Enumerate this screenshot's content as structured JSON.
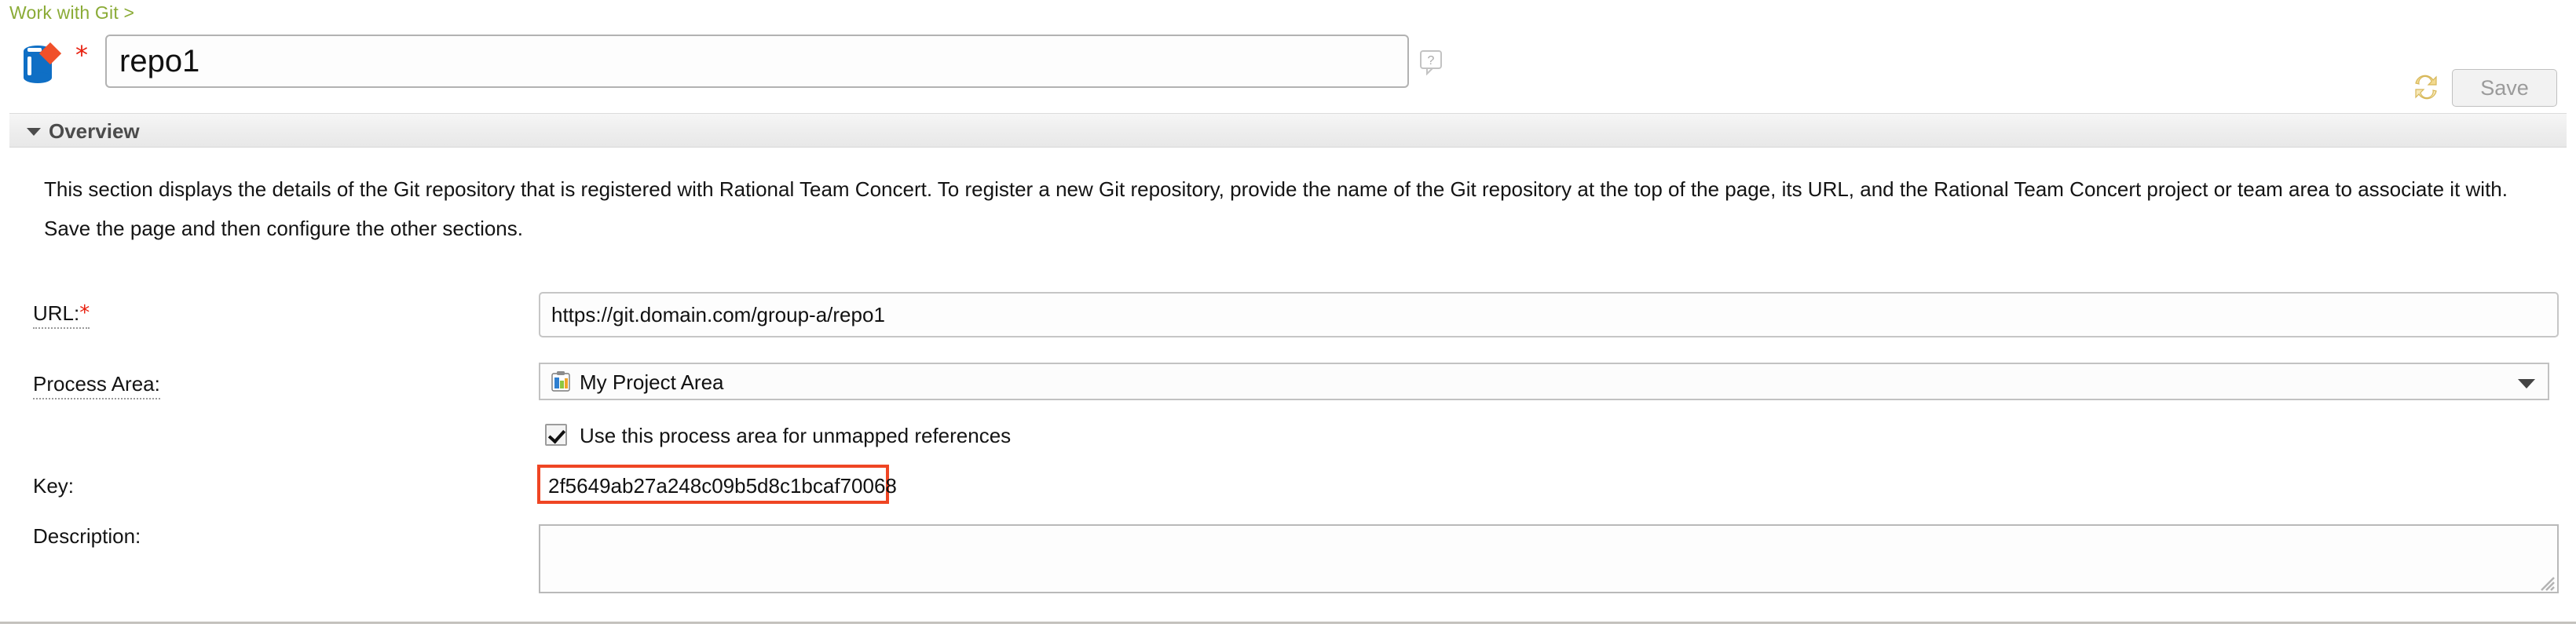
{
  "breadcrumb": {
    "text": "Work with Git >"
  },
  "header": {
    "icon_name": "git-repository-icon",
    "required_marker": "*",
    "name_value": "repo1",
    "name_placeholder": "",
    "help_icon_name": "help-bubble-icon",
    "sync_icon_name": "sync-refresh-icon",
    "save_label": "Save",
    "save_enabled": false
  },
  "section": {
    "twisty_icon_name": "triangle-down-icon",
    "title": "Overview",
    "paragraph_1": "This section displays the details of the Git repository that is registered with Rational Team Concert. To register a new Git repository, provide the name of the Git repository at the top of the page, its URL, and the Rational Team Concert project or team area to associate it with.",
    "paragraph_2": "Save the page and then configure the other sections."
  },
  "form": {
    "url": {
      "label": "URL:",
      "required_marker": "*",
      "value": "https://git.domain.com/group-a/repo1",
      "placeholder": ""
    },
    "process_area": {
      "label": "Process Area:",
      "icon_name": "project-area-icon",
      "selected": "My Project Area",
      "arrow_icon_name": "chevron-down-icon"
    },
    "unmapped": {
      "label": "Use this process area for unmapped references",
      "checked": true
    },
    "key": {
      "label": "Key:",
      "value": "2f5649ab27a248c09b5d8c1bcaf70068",
      "highlight_color": "#ef4523"
    },
    "description": {
      "label": "Description:",
      "value": "",
      "placeholder": ""
    }
  },
  "colors": {
    "breadcrumb": "#8aab36",
    "required_star": "#e8200f",
    "annotation": "#ef4523",
    "section_title": "#4b4b4b"
  }
}
